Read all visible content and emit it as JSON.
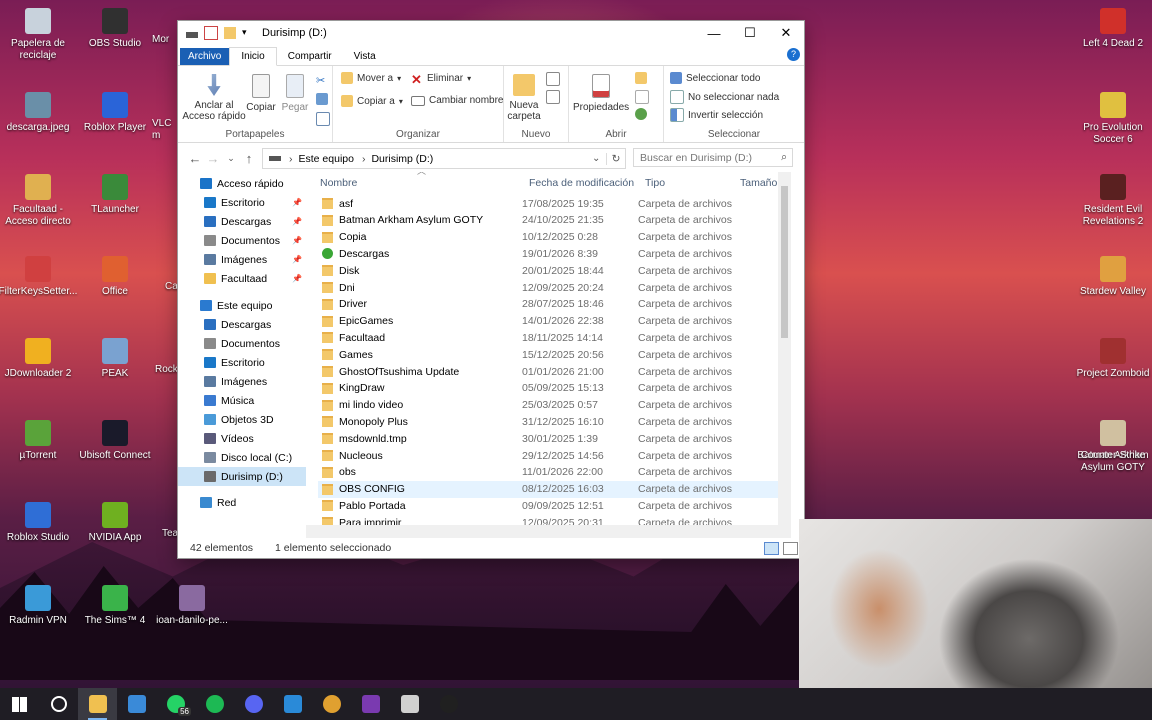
{
  "desktop": {
    "icons_left": [
      {
        "label": "Papelera de reciclaje",
        "color": "#c8d2dc"
      },
      {
        "label": "descarga.jpeg",
        "color": "#6a8fa8"
      },
      {
        "label": "Facultaad - Acceso directo",
        "color": "#e0b050"
      },
      {
        "label": "FilterKeysSetter...",
        "color": "#d04040"
      },
      {
        "label": "JDownloader 2",
        "color": "#f0b020"
      },
      {
        "label": "µTorrent",
        "color": "#5aa33a"
      },
      {
        "label": "Roblox Studio",
        "color": "#2f6ed6"
      },
      {
        "label": "Radmin VPN",
        "color": "#3a9ad8"
      }
    ],
    "icons_mid": [
      {
        "label": "OBS Studio",
        "color": "#303030"
      },
      {
        "label": "Roblox Player",
        "color": "#2a64d8"
      },
      {
        "label": "TLauncher",
        "color": "#3a8a3a"
      },
      {
        "label": "Office",
        "color": "#e06030"
      },
      {
        "label": "PEAK",
        "color": "#7aa2d0"
      },
      {
        "label": "Ubisoft Connect",
        "color": "#1a1a2a"
      },
      {
        "label": "NVIDIA App",
        "color": "#6fb020"
      },
      {
        "label": "The Sims™ 4",
        "color": "#3ab34a"
      }
    ],
    "icons_partial": [
      {
        "label": "Mor"
      },
      {
        "label": "VLC m"
      },
      {
        "label": "Ca"
      },
      {
        "label": "Rock"
      },
      {
        "label": "Tea"
      }
    ],
    "icon_extra": {
      "label": "ioan-danilo-pe...",
      "color": "#8a6aa0"
    },
    "icons_right": [
      {
        "label": "Left 4 Dead 2",
        "color": "#d0302a"
      },
      {
        "label": "Pro Evolution Soccer 6",
        "color": "#e0c040"
      },
      {
        "label": "Resident Evil Revelations 2",
        "color": "#5a2020"
      },
      {
        "label": "Stardew Valley",
        "color": "#e0a040"
      },
      {
        "label": "Project Zomboid",
        "color": "#a03030"
      },
      {
        "label": "Batman Arkham Asylum GOTY",
        "color": "#222222"
      },
      {
        "label": "Counter-Strike",
        "color": "#d0c0a0"
      }
    ]
  },
  "window": {
    "title": "Durisimp (D:)",
    "controls": {
      "minimize": "—",
      "maximize": "☐",
      "close": "✕"
    },
    "tabs": {
      "file": "Archivo",
      "home": "Inicio",
      "share": "Compartir",
      "view": "Vista"
    },
    "help": "?",
    "ribbon": {
      "clipboard": {
        "name": "Portapapeles",
        "pin": "Anclar al Acceso rápido",
        "copy": "Copiar",
        "paste": "Pegar"
      },
      "organize": {
        "name": "Organizar",
        "move_to": "Mover a",
        "copy_to": "Copiar a",
        "delete": "Eliminar",
        "rename": "Cambiar nombre"
      },
      "new": {
        "name": "Nuevo",
        "new_folder": "Nueva carpeta"
      },
      "open": {
        "name": "Abrir",
        "properties": "Propiedades"
      },
      "select": {
        "name": "Seleccionar",
        "select_all": "Seleccionar todo",
        "select_none": "No seleccionar nada",
        "invert": "Invertir selección"
      }
    },
    "address": {
      "crumbs": [
        "Este equipo",
        "Durisimp (D:)"
      ]
    },
    "search": {
      "placeholder": "Buscar en Durisimp (D:)"
    },
    "nav": [
      {
        "label": "Acceso rápido",
        "color": "#1a73c8",
        "pinned": false
      },
      {
        "label": "Escritorio",
        "color": "#1a78c8",
        "pinned": true
      },
      {
        "label": "Descargas",
        "color": "#2a6fc0",
        "pinned": true
      },
      {
        "label": "Documentos",
        "color": "#8a8a8a",
        "pinned": true
      },
      {
        "label": "Imágenes",
        "color": "#5a7aa0",
        "pinned": true
      },
      {
        "label": "Facultaad",
        "color": "#f0c050",
        "pinned": true
      },
      {
        "label": "Este equipo",
        "color": "#2a7ad0",
        "pinned": false
      },
      {
        "label": "Descargas",
        "color": "#2a6fc0",
        "pinned": false
      },
      {
        "label": "Documentos",
        "color": "#8a8a8a",
        "pinned": false
      },
      {
        "label": "Escritorio",
        "color": "#1a78c8",
        "pinned": false
      },
      {
        "label": "Imágenes",
        "color": "#5a7aa0",
        "pinned": false
      },
      {
        "label": "Música",
        "color": "#3a7ad0",
        "pinned": false
      },
      {
        "label": "Objetos 3D",
        "color": "#4a9ad8",
        "pinned": false
      },
      {
        "label": "Vídeos",
        "color": "#5a5a7a",
        "pinned": false
      },
      {
        "label": "Disco local (C:)",
        "color": "#7a8aa0",
        "pinned": false
      },
      {
        "label": "Durisimp (D:)",
        "color": "#6a6a6a",
        "pinned": false,
        "selected": true
      },
      {
        "label": "Red",
        "color": "#3a8ad0",
        "pinned": false
      }
    ],
    "columns": {
      "name": "Nombre",
      "date": "Fecha de modificación",
      "type": "Tipo",
      "size": "Tamaño"
    },
    "files": [
      {
        "name": "asf",
        "date": "17/08/2025 19:35",
        "type": "Carpeta de archivos"
      },
      {
        "name": "Batman Arkham Asylum GOTY",
        "date": "24/10/2025 21:35",
        "type": "Carpeta de archivos"
      },
      {
        "name": "Copia",
        "date": "10/12/2025 0:28",
        "type": "Carpeta de archivos"
      },
      {
        "name": "Descargas",
        "date": "19/01/2026 8:39",
        "type": "Carpeta de archivos",
        "icon": "green"
      },
      {
        "name": "Disk",
        "date": "20/01/2025 18:44",
        "type": "Carpeta de archivos"
      },
      {
        "name": "Dni",
        "date": "12/09/2025 20:24",
        "type": "Carpeta de archivos"
      },
      {
        "name": "Driver",
        "date": "28/07/2025 18:46",
        "type": "Carpeta de archivos"
      },
      {
        "name": "EpicGames",
        "date": "14/01/2026 22:38",
        "type": "Carpeta de archivos"
      },
      {
        "name": "Facultaad",
        "date": "18/11/2025 14:14",
        "type": "Carpeta de archivos"
      },
      {
        "name": "Games",
        "date": "15/12/2025 20:56",
        "type": "Carpeta de archivos"
      },
      {
        "name": "GhostOfTsushima Update",
        "date": "01/01/2026 21:00",
        "type": "Carpeta de archivos"
      },
      {
        "name": "KingDraw",
        "date": "05/09/2025 15:13",
        "type": "Carpeta de archivos"
      },
      {
        "name": "mi lindo video",
        "date": "25/03/2025 0:57",
        "type": "Carpeta de archivos"
      },
      {
        "name": "Monopoly Plus",
        "date": "31/12/2025 16:10",
        "type": "Carpeta de archivos"
      },
      {
        "name": "msdownld.tmp",
        "date": "30/01/2025 1:39",
        "type": "Carpeta de archivos"
      },
      {
        "name": "Nucleous",
        "date": "29/12/2025 14:56",
        "type": "Carpeta de archivos"
      },
      {
        "name": "obs",
        "date": "11/01/2026 22:00",
        "type": "Carpeta de archivos"
      },
      {
        "name": "OBS CONFIG",
        "date": "08/12/2025 16:03",
        "type": "Carpeta de archivos",
        "hover": true
      },
      {
        "name": "Pablo Portada",
        "date": "09/09/2025 12:51",
        "type": "Carpeta de archivos"
      },
      {
        "name": "Para imprimir",
        "date": "12/09/2025 20:31",
        "type": "Carpeta de archivos"
      }
    ],
    "status": {
      "count": "42 elementos",
      "selection": "1 elemento seleccionado"
    }
  },
  "taskbar": {
    "items": [
      {
        "name": "start",
        "color": "#ffffff"
      },
      {
        "name": "search",
        "color": "#ffffff"
      },
      {
        "name": "file-explorer",
        "color": "#f0c050",
        "active": true
      },
      {
        "name": "store",
        "color": "#3a8ad8"
      },
      {
        "name": "whatsapp",
        "color": "#25d366",
        "badge": "56"
      },
      {
        "name": "spotify",
        "color": "#1db954"
      },
      {
        "name": "discord",
        "color": "#5865f2"
      },
      {
        "name": "vscode",
        "color": "#2a8ad8"
      },
      {
        "name": "chrome",
        "color": "#e0a030"
      },
      {
        "name": "onenote",
        "color": "#7a3ab0"
      },
      {
        "name": "app-bird",
        "color": "#d0d0d0"
      },
      {
        "name": "obs",
        "color": "#202020"
      }
    ]
  }
}
